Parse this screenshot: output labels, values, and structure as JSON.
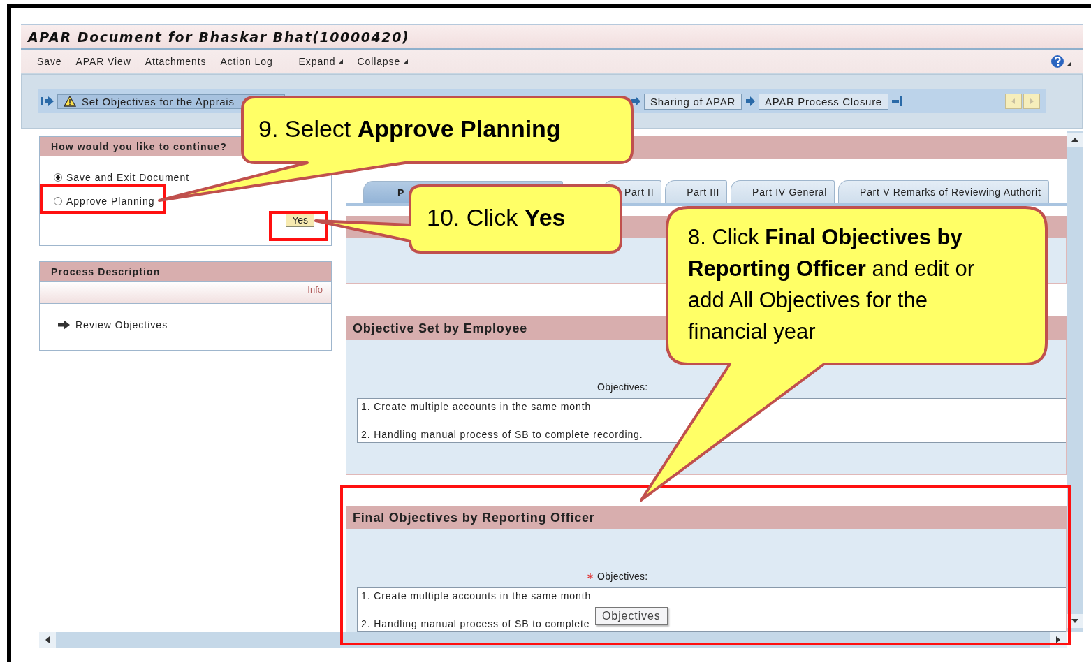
{
  "window": {
    "title": "APAR Document for Bhaskar Bhat(10000420)"
  },
  "toolbar": {
    "actions": [
      {
        "label": "Save"
      },
      {
        "label": "APAR View"
      },
      {
        "label": "Attachments"
      },
      {
        "label": "Action Log"
      }
    ],
    "menus": [
      {
        "label": "Expand"
      },
      {
        "label": "Collapse"
      }
    ]
  },
  "roadmap": {
    "steps": [
      {
        "label": "Set Objectives for the Apprais",
        "current": true,
        "warning": true
      },
      {
        "label": "Sharing of APAR",
        "current": false,
        "warning": false
      },
      {
        "label": "APAR Process Closure",
        "current": false,
        "warning": false
      }
    ]
  },
  "decision_panel": {
    "title": "How would you like to continue?",
    "options": [
      {
        "label": "Save and Exit Document",
        "selected": true
      },
      {
        "label": "Approve Planning",
        "selected": false
      }
    ],
    "button": "Yes"
  },
  "process_panel": {
    "title": "Process Description",
    "info": "Info",
    "steps": [
      "Review Objectives"
    ]
  },
  "tabs": [
    {
      "label": "P",
      "selected": true
    },
    {
      "label": "Part II",
      "selected": false
    },
    {
      "label": "Part III",
      "selected": false
    },
    {
      "label": "Part IV General",
      "selected": false
    },
    {
      "label": "Part V Remarks of Reviewing Authorit",
      "selected": false
    }
  ],
  "sections": [
    {
      "title": "Objective Set by Employee",
      "field_label": "Objectives:",
      "required": false,
      "lines": [
        "1. Create multiple accounts in the same month",
        "2. Handling manual process of SB to complete recording."
      ]
    },
    {
      "title": "Final Objectives by Reporting Officer",
      "field_label": "Objectives:",
      "required": true,
      "lines": [
        "1. Create multiple accounts in the same month",
        "2. Handling manual process of SB to complete"
      ],
      "tooltip": "Objectives"
    }
  ],
  "callouts": [
    {
      "text": "9. Select **Approve Planning**"
    },
    {
      "text": "10. Click **Yes**"
    },
    {
      "text": "8. Click **Final Objectives by Reporting Officer** and edit or add All Objectives for the financial year"
    }
  ]
}
